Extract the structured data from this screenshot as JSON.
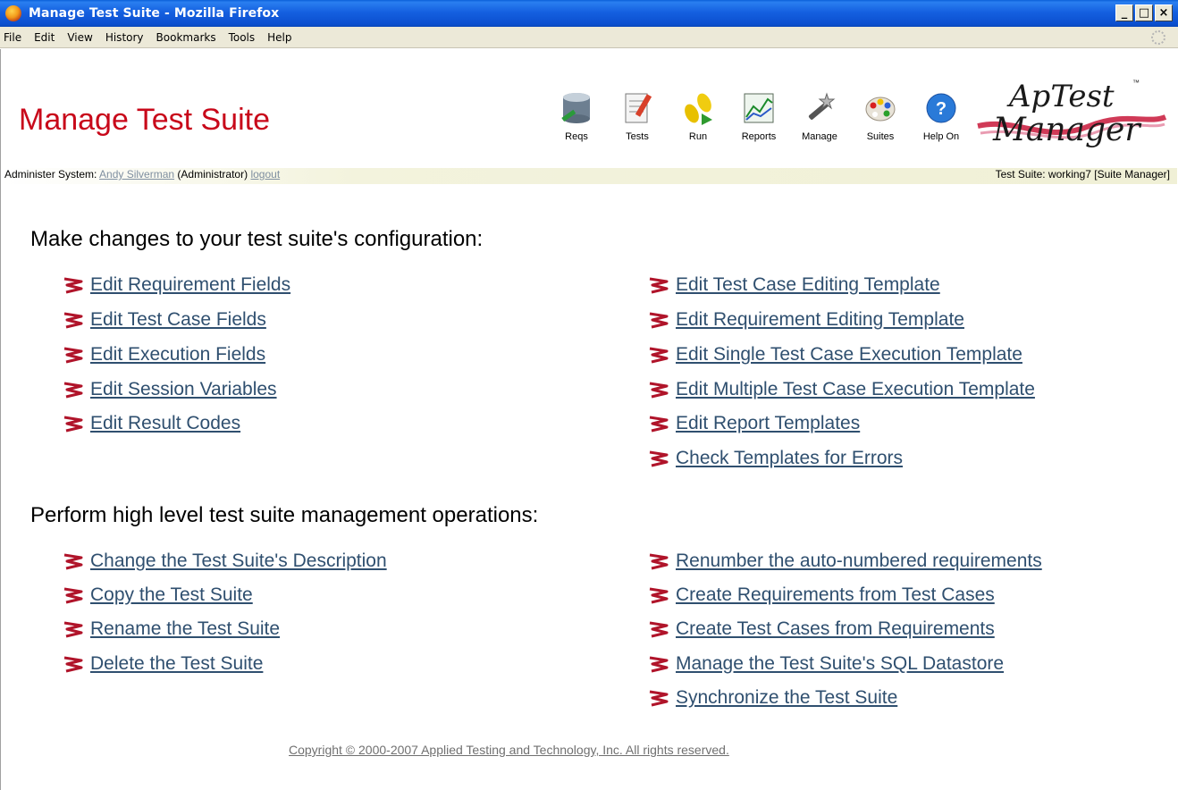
{
  "window": {
    "title": "Manage Test Suite - Mozilla Firefox",
    "min": "_",
    "max": "□",
    "close": "×"
  },
  "menu": [
    "File",
    "Edit",
    "View",
    "History",
    "Bookmarks",
    "Tools",
    "Help"
  ],
  "page": {
    "title": "Manage Test Suite",
    "toolbar": [
      "Reqs",
      "Tests",
      "Run",
      "Reports",
      "Manage",
      "Suites",
      "Help On"
    ],
    "logo": {
      "line1": "ApTest",
      "line2": "Manager",
      "tm": "™"
    },
    "admin": {
      "prefix": "Administer System:",
      "user": "Andy Silverman",
      "role": "(Administrator)",
      "logout": "logout",
      "suite": "Test Suite: working7 [Suite Manager]"
    },
    "config": {
      "heading": "Make changes to your test suite's configuration:",
      "left": [
        "Edit Requirement Fields",
        "Edit Test Case Fields",
        "Edit Execution Fields",
        "Edit Session Variables",
        "Edit Result Codes"
      ],
      "right": [
        "Edit Test Case Editing Template",
        "Edit Requirement Editing Template",
        "Edit Single Test Case Execution Template",
        "Edit Multiple Test Case Execution Template",
        "Edit Report Templates",
        "Check Templates for Errors"
      ]
    },
    "management": {
      "heading": "Perform high level test suite management operations:",
      "left": [
        "Change the Test Suite's Description",
        "Copy the Test Suite",
        "Rename the Test Suite",
        "Delete the Test Suite"
      ],
      "right": [
        "Renumber the auto-numbered requirements",
        "Create Requirements from Test Cases",
        "Create Test Cases from Requirements",
        "Manage the Test Suite's SQL Datastore",
        "Synchronize the Test Suite"
      ]
    },
    "copyright": "Copyright © 2000-2007 Applied Testing and Technology, Inc. All rights reserved."
  },
  "colors": {
    "title_red": "#c8081a",
    "link": "#2f4f6f",
    "titlebar_blue": "#0b4fcf"
  }
}
